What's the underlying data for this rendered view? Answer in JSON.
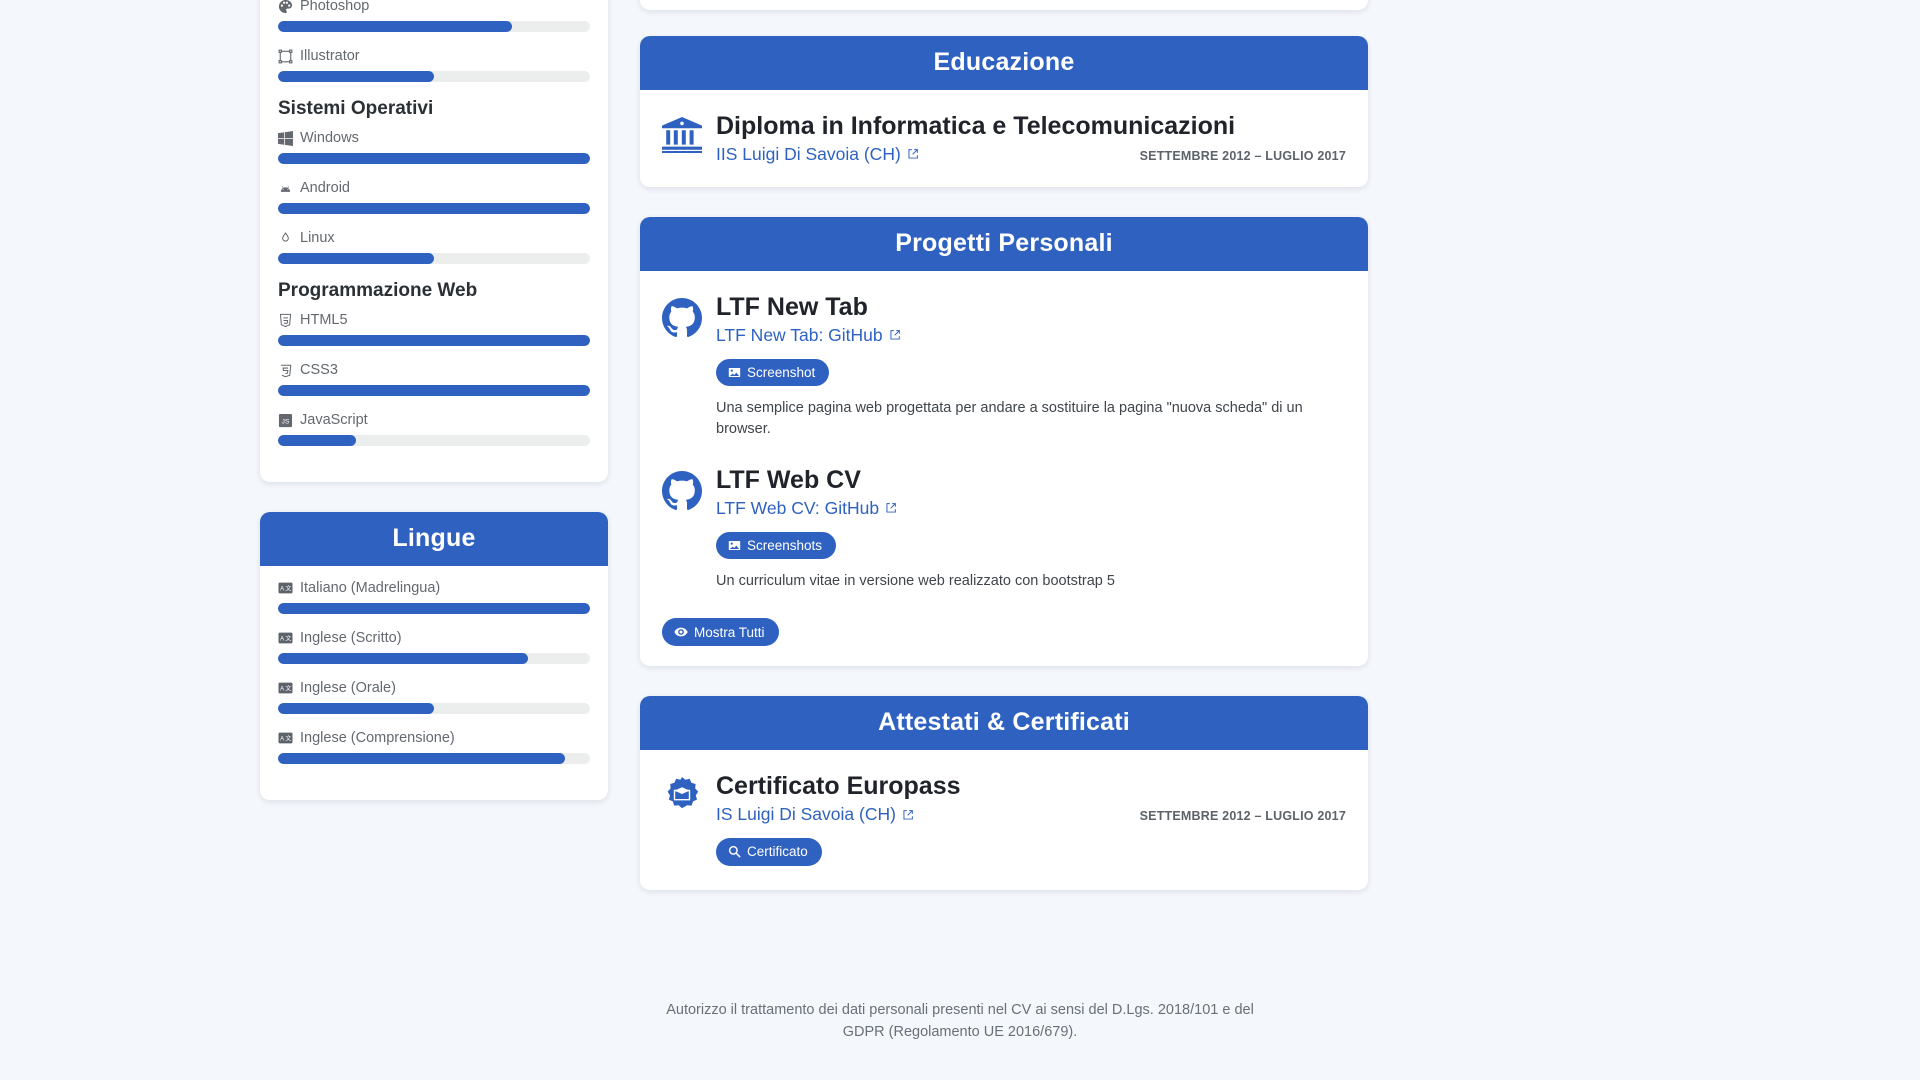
{
  "theme": {
    "accent": "#2f62c0",
    "page_bg": "#f4f7fb",
    "track": "#eceded",
    "muted": "#63696f"
  },
  "skills_card": {
    "partial_top_items": [
      {
        "label": "Photoshop",
        "icon": "palette-icon",
        "value": 75
      },
      {
        "label": "Illustrator",
        "icon": "vector-square-icon",
        "value": 50
      }
    ],
    "groups": [
      {
        "title": "Sistemi Operativi",
        "items": [
          {
            "label": "Windows",
            "icon": "windows-icon",
            "value": 100
          },
          {
            "label": "Android",
            "icon": "android-icon",
            "value": 100
          },
          {
            "label": "Linux",
            "icon": "linux-tux-icon",
            "value": 50
          }
        ]
      },
      {
        "title": "Programmazione Web",
        "items": [
          {
            "label": "HTML5",
            "icon": "html5-icon",
            "value": 100
          },
          {
            "label": "CSS3",
            "icon": "css3-icon",
            "value": 100
          },
          {
            "label": "JavaScript",
            "icon": "javascript-icon",
            "value": 25
          }
        ]
      }
    ]
  },
  "languages_card": {
    "title": "Lingue",
    "items": [
      {
        "label": "Italiano (Madrelingua)",
        "icon": "language-icon",
        "value": 100
      },
      {
        "label": "Inglese (Scritto)",
        "icon": "language-icon",
        "value": 80
      },
      {
        "label": "Inglese (Orale)",
        "icon": "language-icon",
        "value": 50
      },
      {
        "label": "Inglese (Comprensione)",
        "icon": "language-icon",
        "value": 92
      }
    ]
  },
  "education_card": {
    "title": "Educazione",
    "entries": [
      {
        "icon": "university-icon",
        "title": "Diploma in Informatica e Telecomunicazioni",
        "link": "IIS Luigi Di Savoia (CH)",
        "date": "SETTEMBRE 2012 – LUGLIO 2017"
      }
    ]
  },
  "projects_card": {
    "title": "Progetti Personali",
    "entries": [
      {
        "icon": "github-icon",
        "title": "LTF New Tab",
        "link": "LTF New Tab: GitHub",
        "button": "Screenshot",
        "button_icon": "image-icon",
        "description": "Una semplice pagina web progettata per andare a sostituire la pagina \"nuova scheda\" di un browser."
      },
      {
        "icon": "github-icon",
        "title": "LTF Web CV",
        "link": "LTF Web CV: GitHub",
        "button": "Screenshots",
        "button_icon": "image-icon",
        "description": "Un curriculum vitae in versione web realizzato con bootstrap 5"
      }
    ],
    "show_all_button": "Mostra Tutti",
    "show_all_icon": "eye-icon"
  },
  "certificates_card": {
    "title": "Attestati & Certificati",
    "entries": [
      {
        "icon": "certificate-badge-icon",
        "title": "Certificato Europass",
        "link": "IS Luigi Di Savoia (CH)",
        "date": "SETTEMBRE 2012 – LUGLIO 2017",
        "button": "Certificato",
        "button_icon": "magnifier-icon"
      }
    ]
  },
  "footer": {
    "line1": "Autorizzo il trattamento dei dati personali presenti nel CV ai sensi del D.Lgs. 2018/101 e del",
    "line2": "GDPR (Regolamento UE 2016/679)."
  }
}
